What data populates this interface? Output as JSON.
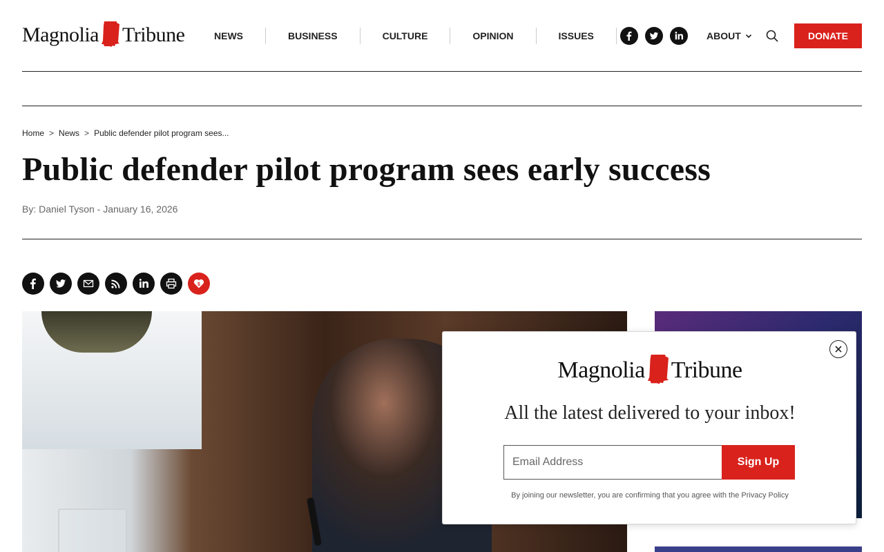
{
  "site": {
    "logo_left": "Magnolia",
    "logo_right": "Tribune",
    "brand_red": "#d9221c"
  },
  "nav": {
    "items": [
      "NEWS",
      "BUSINESS",
      "CULTURE",
      "OPINION",
      "ISSUES"
    ],
    "social": [
      "facebook-icon",
      "twitter-icon",
      "linkedin-icon"
    ],
    "about_label": "ABOUT",
    "donate_label": "DONATE"
  },
  "breadcrumb": {
    "home": "Home",
    "sep": ">",
    "section": "News",
    "current": "Public defender pilot program sees..."
  },
  "article": {
    "headline": "Public defender pilot program sees early success",
    "byline": "By: Daniel Tyson - January 16, 2026",
    "share_icons": [
      "facebook-icon",
      "twitter-icon",
      "email-icon",
      "rss-icon",
      "linkedin-icon",
      "print-icon",
      "donate-heart-icon"
    ]
  },
  "newsletter": {
    "logo_left": "Magnolia",
    "logo_right": "Tribune",
    "tagline": "All the latest delivered to your inbox!",
    "email_placeholder": "Email Address",
    "signup_label": "Sign Up",
    "legal": "By joining our newsletter, you are confirming that you agree with the Privacy Policy"
  }
}
